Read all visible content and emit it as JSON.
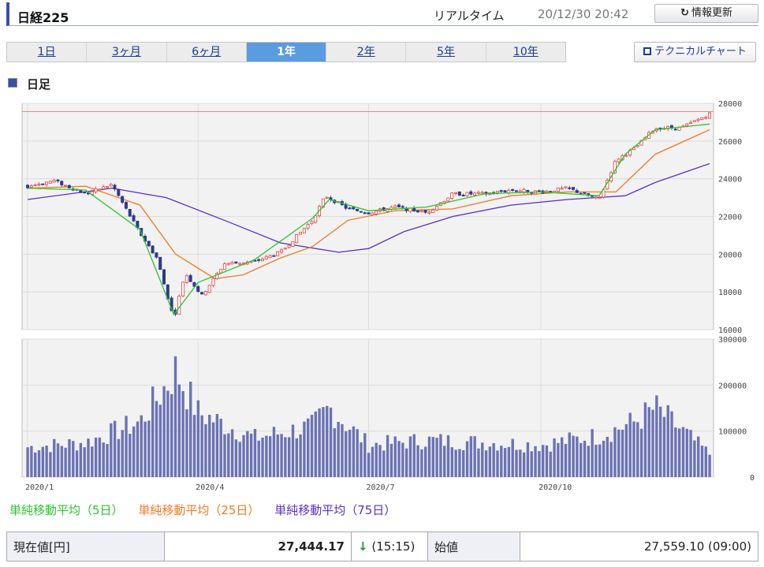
{
  "header": {
    "title": "日経225",
    "realtime_label": "リアルタイム",
    "timestamp": "20/12/30 20:42",
    "refresh_label": "情報更新"
  },
  "tabs": [
    {
      "label": "1日",
      "active": false
    },
    {
      "label": "3ヶ月",
      "active": false
    },
    {
      "label": "6ヶ月",
      "active": false
    },
    {
      "label": "1年",
      "active": true
    },
    {
      "label": "2年",
      "active": false
    },
    {
      "label": "5年",
      "active": false
    },
    {
      "label": "10年",
      "active": false
    }
  ],
  "technical_chart_label": "テクニカルチャート",
  "section_title": "日足",
  "legend": {
    "ma5": "単純移動平均（5日）",
    "ma25": "単純移動平均（25日）",
    "ma75": "単純移動平均（75日）"
  },
  "colors": {
    "ma5": "#2ec42e",
    "ma25": "#f07a23",
    "ma75": "#5a2fc8",
    "volume": "#6b72b4",
    "up_candle": "#e04040",
    "down_candle": "#2d3a8f",
    "reference_line": "#ff8080"
  },
  "quote": {
    "current_label": "現在値[円]",
    "current_value": "27,444.17",
    "arrow": "↓",
    "current_time": "(15:15)",
    "open_label": "始値",
    "open_value": "27,559.10 (09:00)"
  },
  "chart_data": {
    "type": "line",
    "x_ticks": [
      "2020/1",
      "2020/4",
      "2020/7",
      "2020/10"
    ],
    "price_yticks": [
      16000,
      18000,
      20000,
      22000,
      24000,
      26000,
      28000
    ],
    "price_ylim": [
      16000,
      28000
    ],
    "volume_yticks": [
      0,
      100000,
      200000,
      300000
    ],
    "volume_ylim": [
      0,
      300000
    ],
    "reference_line": 27560,
    "close_series": [
      {
        "date": "2020/01/01",
        "close": 23600
      },
      {
        "date": "2020/01/15",
        "close": 23900
      },
      {
        "date": "2020/02/01",
        "close": 23200
      },
      {
        "date": "2020/02/15",
        "close": 23700
      },
      {
        "date": "2020/03/01",
        "close": 21100
      },
      {
        "date": "2020/03/10",
        "close": 19800
      },
      {
        "date": "2020/03/19",
        "close": 16550
      },
      {
        "date": "2020/03/25",
        "close": 19000
      },
      {
        "date": "2020/04/03",
        "close": 17800
      },
      {
        "date": "2020/04/15",
        "close": 19500
      },
      {
        "date": "2020/05/01",
        "close": 19600
      },
      {
        "date": "2020/05/15",
        "close": 20100
      },
      {
        "date": "2020/06/01",
        "close": 21800
      },
      {
        "date": "2020/06/08",
        "close": 23100
      },
      {
        "date": "2020/06/20",
        "close": 22400
      },
      {
        "date": "2020/07/01",
        "close": 22200
      },
      {
        "date": "2020/07/15",
        "close": 22500
      },
      {
        "date": "2020/08/01",
        "close": 22200
      },
      {
        "date": "2020/08/15",
        "close": 23200
      },
      {
        "date": "2020/09/01",
        "close": 23200
      },
      {
        "date": "2020/09/15",
        "close": 23400
      },
      {
        "date": "2020/10/01",
        "close": 23300
      },
      {
        "date": "2020/10/15",
        "close": 23500
      },
      {
        "date": "2020/11/01",
        "close": 22900
      },
      {
        "date": "2020/11/10",
        "close": 25000
      },
      {
        "date": "2020/11/20",
        "close": 25600
      },
      {
        "date": "2020/12/01",
        "close": 26700
      },
      {
        "date": "2020/12/15",
        "close": 26700
      },
      {
        "date": "2020/12/30",
        "close": 27444
      }
    ],
    "ma5": [
      {
        "date": "2020/01/01",
        "value": 23500
      },
      {
        "date": "2020/02/01",
        "value": 23400
      },
      {
        "date": "2020/03/01",
        "value": 21300
      },
      {
        "date": "2020/03/19",
        "value": 16800
      },
      {
        "date": "2020/04/01",
        "value": 18500
      },
      {
        "date": "2020/05/01",
        "value": 19700
      },
      {
        "date": "2020/06/01",
        "value": 21900
      },
      {
        "date": "2020/06/10",
        "value": 22900
      },
      {
        "date": "2020/07/01",
        "value": 22300
      },
      {
        "date": "2020/08/01",
        "value": 22500
      },
      {
        "date": "2020/09/01",
        "value": 23200
      },
      {
        "date": "2020/10/01",
        "value": 23300
      },
      {
        "date": "2020/11/01",
        "value": 23100
      },
      {
        "date": "2020/11/15",
        "value": 25300
      },
      {
        "date": "2020/12/01",
        "value": 26600
      },
      {
        "date": "2020/12/30",
        "value": 26900
      }
    ],
    "ma25": [
      {
        "date": "2020/01/01",
        "value": 23500
      },
      {
        "date": "2020/02/01",
        "value": 23600
      },
      {
        "date": "2020/03/01",
        "value": 22600
      },
      {
        "date": "2020/03/20",
        "value": 20000
      },
      {
        "date": "2020/04/10",
        "value": 18700
      },
      {
        "date": "2020/04/25",
        "value": 18900
      },
      {
        "date": "2020/05/15",
        "value": 19800
      },
      {
        "date": "2020/06/01",
        "value": 20400
      },
      {
        "date": "2020/06/20",
        "value": 21800
      },
      {
        "date": "2020/07/15",
        "value": 22300
      },
      {
        "date": "2020/08/15",
        "value": 22400
      },
      {
        "date": "2020/09/15",
        "value": 23100
      },
      {
        "date": "2020/10/15",
        "value": 23300
      },
      {
        "date": "2020/11/10",
        "value": 23300
      },
      {
        "date": "2020/12/01",
        "value": 25300
      },
      {
        "date": "2020/12/30",
        "value": 26600
      }
    ],
    "ma75": [
      {
        "date": "2020/01/01",
        "value": 22900
      },
      {
        "date": "2020/02/15",
        "value": 23500
      },
      {
        "date": "2020/03/15",
        "value": 23000
      },
      {
        "date": "2020/04/15",
        "value": 21800
      },
      {
        "date": "2020/05/15",
        "value": 20600
      },
      {
        "date": "2020/06/15",
        "value": 20100
      },
      {
        "date": "2020/07/01",
        "value": 20300
      },
      {
        "date": "2020/07/20",
        "value": 21200
      },
      {
        "date": "2020/08/15",
        "value": 22000
      },
      {
        "date": "2020/09/15",
        "value": 22600
      },
      {
        "date": "2020/10/15",
        "value": 22900
      },
      {
        "date": "2020/11/15",
        "value": 23100
      },
      {
        "date": "2020/12/01",
        "value": 23800
      },
      {
        "date": "2020/12/30",
        "value": 24800
      }
    ],
    "volume": [
      {
        "date": "2020/01/01",
        "value": 65000
      },
      {
        "date": "2020/02/01",
        "value": 75000
      },
      {
        "date": "2020/03/01",
        "value": 120000
      },
      {
        "date": "2020/03/15",
        "value": 200000
      },
      {
        "date": "2020/03/20",
        "value": 232000
      },
      {
        "date": "2020/04/01",
        "value": 140000
      },
      {
        "date": "2020/05/01",
        "value": 85000
      },
      {
        "date": "2020/06/01",
        "value": 110000
      },
      {
        "date": "2020/06/10",
        "value": 150000
      },
      {
        "date": "2020/07/01",
        "value": 70000
      },
      {
        "date": "2020/08/01",
        "value": 80000
      },
      {
        "date": "2020/09/01",
        "value": 75000
      },
      {
        "date": "2020/10/01",
        "value": 70000
      },
      {
        "date": "2020/11/01",
        "value": 90000
      },
      {
        "date": "2020/11/20",
        "value": 120000
      },
      {
        "date": "2020/12/01",
        "value": 150000
      },
      {
        "date": "2020/12/30",
        "value": 50000
      }
    ]
  }
}
